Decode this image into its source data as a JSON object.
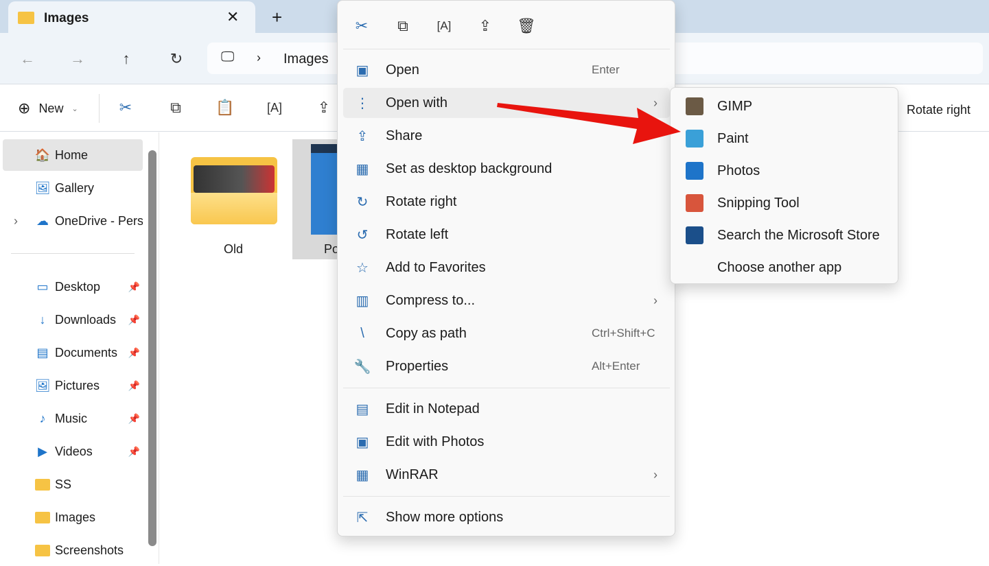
{
  "tab": {
    "title": "Images",
    "close_icon": "close-icon",
    "new_tab_icon": "plus-icon"
  },
  "nav": {
    "breadcrumb": [
      "Images"
    ]
  },
  "cmdbar": {
    "new_label": "New",
    "rotate_right": "Rotate right"
  },
  "sidebar": {
    "items": [
      {
        "label": "Home",
        "icon": "home-icon",
        "selected": true
      },
      {
        "label": "Gallery",
        "icon": "gallery-icon"
      },
      {
        "label": "OneDrive - Perso",
        "icon": "cloud-icon",
        "expandable": true
      },
      {
        "label": "Desktop",
        "icon": "desktop-icon",
        "pinned": true
      },
      {
        "label": "Downloads",
        "icon": "download-icon",
        "pinned": true
      },
      {
        "label": "Documents",
        "icon": "document-icon",
        "pinned": true
      },
      {
        "label": "Pictures",
        "icon": "pictures-icon",
        "pinned": true
      },
      {
        "label": "Music",
        "icon": "music-icon",
        "pinned": true
      },
      {
        "label": "Videos",
        "icon": "video-icon",
        "pinned": true
      },
      {
        "label": "SS",
        "icon": "folder-icon"
      },
      {
        "label": "Images",
        "icon": "folder-icon"
      },
      {
        "label": "Screenshots",
        "icon": "folder-icon"
      }
    ]
  },
  "files": [
    {
      "name": "Old"
    },
    {
      "name": "Po"
    }
  ],
  "context_menu": {
    "top_icons": [
      "cut-icon",
      "copy-icon",
      "rename-icon",
      "share-icon",
      "delete-icon"
    ],
    "items": [
      {
        "label": "Open",
        "shortcut": "Enter",
        "icon": "photos-icon"
      },
      {
        "label": "Open with",
        "icon": "open-with-icon",
        "submenu": true,
        "highlighted": true
      },
      {
        "label": "Share",
        "icon": "share-icon"
      },
      {
        "label": "Set as desktop background",
        "icon": "wallpaper-icon"
      },
      {
        "label": "Rotate right",
        "icon": "rotate-right-icon"
      },
      {
        "label": "Rotate left",
        "icon": "rotate-left-icon"
      },
      {
        "label": "Add to Favorites",
        "icon": "star-icon"
      },
      {
        "label": "Compress to...",
        "icon": "zip-icon",
        "submenu": true
      },
      {
        "label": "Copy as path",
        "shortcut": "Ctrl+Shift+C",
        "icon": "path-icon"
      },
      {
        "label": "Properties",
        "shortcut": "Alt+Enter",
        "icon": "wrench-icon"
      },
      {
        "label": "Edit in Notepad",
        "icon": "notepad-icon"
      },
      {
        "label": "Edit with Photos",
        "icon": "photos-icon"
      },
      {
        "label": "WinRAR",
        "icon": "winrar-icon",
        "submenu": true
      },
      {
        "label": "Show more options",
        "icon": "more-options-icon"
      }
    ]
  },
  "open_with_submenu": [
    {
      "label": "GIMP",
      "icon": "gimp-icon"
    },
    {
      "label": "Paint",
      "icon": "paint-icon"
    },
    {
      "label": "Photos",
      "icon": "photos-icon"
    },
    {
      "label": "Snipping Tool",
      "icon": "snipping-tool-icon"
    },
    {
      "label": "Search the Microsoft Store",
      "icon": "store-icon"
    },
    {
      "label": "Choose another app",
      "icon": ""
    }
  ],
  "colors": {
    "accent": "#0067c0",
    "annotation_arrow": "#e8140e",
    "folder": "#f6c344"
  }
}
